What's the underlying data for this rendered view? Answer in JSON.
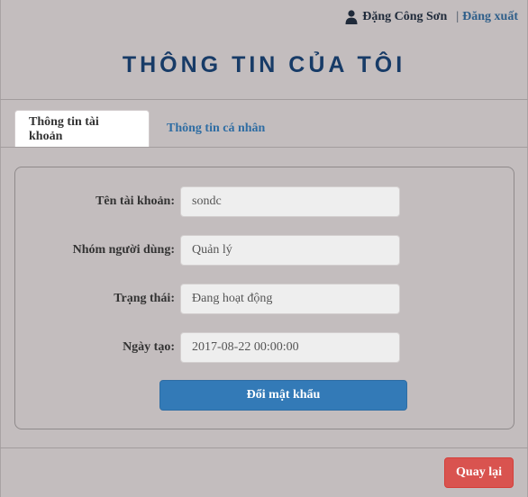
{
  "header": {
    "username": "Đặng Công Sơn",
    "separator": "|",
    "logout_label": "Đăng xuất",
    "user_icon": "user-icon"
  },
  "page_title": "THÔNG TIN CỦA TÔI",
  "tabs": [
    {
      "label": "Thông tin tài khoản",
      "active": true
    },
    {
      "label": "Thông tin cá nhân",
      "active": false
    }
  ],
  "form": {
    "fields": [
      {
        "label": "Tên tài khoản:",
        "value": "sondc"
      },
      {
        "label": "Nhóm người dùng:",
        "value": "Quản lý"
      },
      {
        "label": "Trạng thái:",
        "value": "Đang hoạt động"
      },
      {
        "label": "Ngày tạo:",
        "value": "2017-08-22 00:00:00"
      }
    ],
    "change_password_label": "Đổi mật khẩu"
  },
  "footer": {
    "back_label": "Quay lại"
  },
  "colors": {
    "background": "#c3bdbe",
    "title": "#173b67",
    "primary": "#337ab7",
    "danger": "#d9534f",
    "link": "#2f6da3"
  }
}
